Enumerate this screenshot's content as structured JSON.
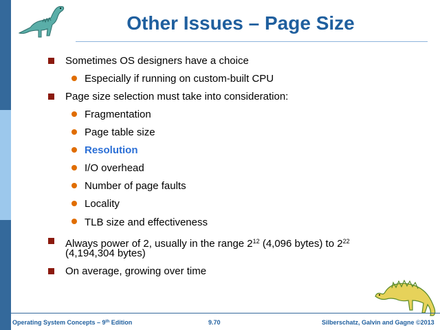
{
  "slide": {
    "title": "Other Issues – Page Size"
  },
  "bullets": [
    {
      "level": 1,
      "text": "Sometimes OS designers have a choice"
    },
    {
      "level": 2,
      "text": "Especially if running on custom-built CPU"
    },
    {
      "level": 1,
      "text": "Page size selection must take into consideration:"
    },
    {
      "level": 2,
      "text": "Fragmentation"
    },
    {
      "level": 2,
      "text": "Page table size"
    },
    {
      "level": 2,
      "text": "Resolution"
    },
    {
      "level": 2,
      "text": "I/O overhead"
    },
    {
      "level": 2,
      "text": "Number of page faults"
    },
    {
      "level": 2,
      "text": "Locality"
    },
    {
      "level": 2,
      "text": "TLB size and effectiveness"
    },
    {
      "level": 1,
      "text_part1": "Always power of 2, usually in the range 2",
      "sup1": "12",
      "text_part2": " (4,096 bytes) to 2",
      "sup2": "22",
      "text_line2": "(4,194,304 bytes)"
    },
    {
      "level": 1,
      "text": "On average, growing over time"
    }
  ],
  "footer": {
    "left_prefix": "Operating System Concepts – 9",
    "left_sup": "th",
    "left_suffix": " Edition",
    "page": "9.70",
    "right": "Silberschatz, Galvin and Gagne ©2013"
  },
  "colors": {
    "title": "#1f5f9e",
    "level1_bullet": "#8b1a0d",
    "level2_bullet": "#e06d00",
    "highlight": "#2b6fd6",
    "sidebar_dark": "#34699b",
    "sidebar_light": "#9cc8ec"
  }
}
